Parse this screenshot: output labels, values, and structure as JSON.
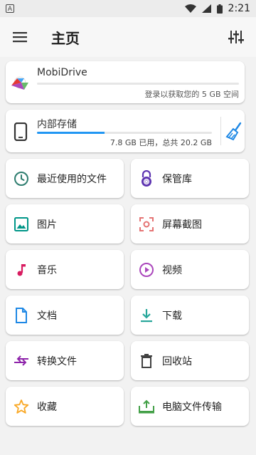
{
  "status_bar": {
    "time": "2:21",
    "notification_badge": "A"
  },
  "app_bar": {
    "title": "主页"
  },
  "drive": {
    "name": "MobiDrive",
    "subtitle": "登录以获取您的 5 GB 空间"
  },
  "storage": {
    "name": "内部存储",
    "usage_text": "7.8 GB 已用，总共 20.2 GB",
    "used_fraction": 0.386
  },
  "tiles": [
    {
      "label": "最近使用的文件",
      "icon": "clock-icon",
      "color": "#2e7d6f"
    },
    {
      "label": "保管库",
      "icon": "vault-lock-icon",
      "color": "#5e35b1"
    },
    {
      "label": "图片",
      "icon": "image-icon",
      "color": "#009688"
    },
    {
      "label": "屏幕截图",
      "icon": "screenshot-icon",
      "color": "#e57373"
    },
    {
      "label": "音乐",
      "icon": "music-note-icon",
      "color": "#d81b60"
    },
    {
      "label": "视频",
      "icon": "play-circle-icon",
      "color": "#ab47bc"
    },
    {
      "label": "文档",
      "icon": "document-icon",
      "color": "#1e88e5"
    },
    {
      "label": "下载",
      "icon": "download-icon",
      "color": "#26a69a"
    },
    {
      "label": "转换文件",
      "icon": "convert-arrows-icon",
      "color": "#8e24aa"
    },
    {
      "label": "回收站",
      "icon": "trash-icon",
      "color": "#424242"
    },
    {
      "label": "收藏",
      "icon": "star-icon",
      "color": "#f9a825"
    },
    {
      "label": "电脑文件传输",
      "icon": "pc-transfer-icon",
      "color": "#43a047"
    }
  ]
}
